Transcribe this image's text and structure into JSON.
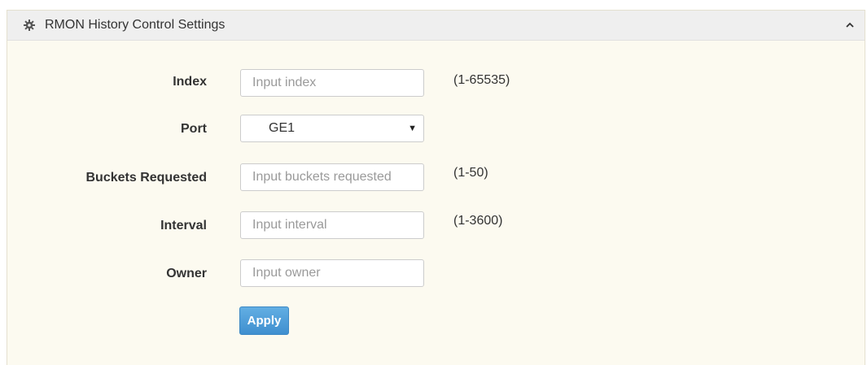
{
  "panel": {
    "title": "RMON History Control Settings",
    "title_icon": "gear-icon",
    "collapse_icon": "chevron-up-icon"
  },
  "form": {
    "index": {
      "label": "Index",
      "placeholder": "Input index",
      "value": "",
      "hint": "(1-65535)"
    },
    "port": {
      "label": "Port",
      "selected": "GE1"
    },
    "buckets": {
      "label": "Buckets Requested",
      "placeholder": "Input buckets requested",
      "value": "",
      "hint": "(1-50)"
    },
    "interval": {
      "label": "Interval",
      "placeholder": "Input interval",
      "value": "",
      "hint": "(1-3600)"
    },
    "owner": {
      "label": "Owner",
      "placeholder": "Input owner",
      "value": ""
    },
    "apply_label": "Apply"
  },
  "colors": {
    "panel_bg": "#fcfaf0",
    "header_bg": "#efefef",
    "button_blue": "#4a9ad6"
  }
}
